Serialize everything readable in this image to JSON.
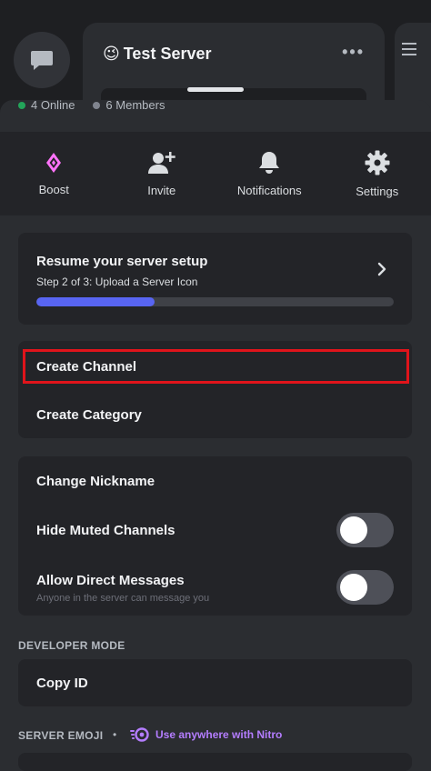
{
  "background": {
    "server_name": "Test Server",
    "server_emoji": "😉",
    "more_label": "•••"
  },
  "stats": {
    "online": "4 Online",
    "members": "6 Members"
  },
  "actions": [
    {
      "label": "Boost",
      "icon": "boost-icon"
    },
    {
      "label": "Invite",
      "icon": "invite-icon"
    },
    {
      "label": "Notifications",
      "icon": "bell-icon"
    },
    {
      "label": "Settings",
      "icon": "gear-icon"
    }
  ],
  "setup": {
    "title": "Resume your server setup",
    "subtitle": "Step 2 of 3: Upload a Server Icon",
    "progress": 0.33
  },
  "menu": {
    "create_channel": "Create Channel",
    "create_category": "Create Category",
    "change_nickname": "Change Nickname",
    "hide_muted": "Hide Muted Channels",
    "allow_dm": "Allow Direct Messages",
    "allow_dm_sub": "Anyone in the server can message you"
  },
  "developer": {
    "header": "DEVELOPER MODE",
    "copy_id": "Copy ID"
  },
  "emoji": {
    "header": "SERVER EMOJI",
    "bullet": "•",
    "nitro_text": "Use anywhere with Nitro"
  },
  "colors": {
    "accent": "#5865f2",
    "highlight": "#e0141b",
    "nitro": "#b47dff",
    "boost": "#ff73fa"
  }
}
